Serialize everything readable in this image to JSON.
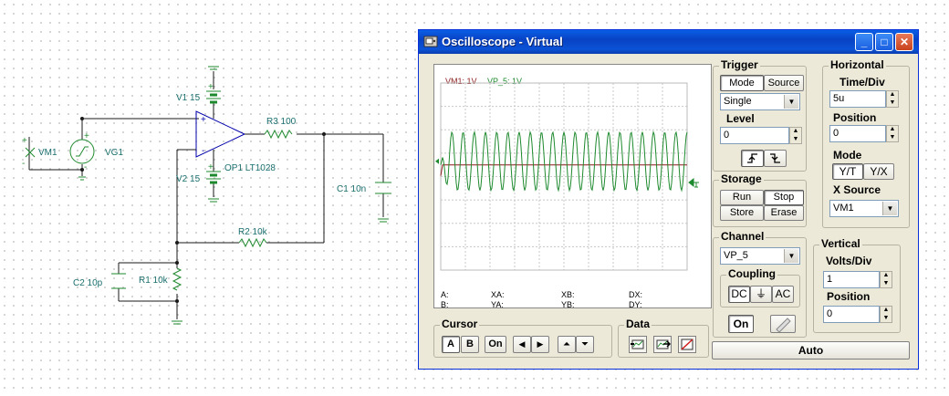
{
  "schematic": {
    "labels": {
      "vm1": "VM1",
      "vg1": "VG1",
      "v1": "V1 15",
      "v2": "V2 15",
      "r3": "R3 100",
      "op1": "OP1 LT1028",
      "c1": "C1 10n",
      "r2": "R2 10k",
      "c2": "C2 10p",
      "r1": "R1 10k"
    },
    "signs": {
      "plus": "+",
      "minus": "-"
    }
  },
  "window": {
    "title": "Oscilloscope - Virtual",
    "controls": {
      "minimize": "_",
      "maximize": "□",
      "close": "✕"
    }
  },
  "scope": {
    "channel_labels": {
      "vm1": "VM1: 1V",
      "vp5": "VP_5: 1V"
    },
    "trace_colors": {
      "vm1": "#8b1a1a",
      "vp5": "#1e8a2e"
    },
    "cursor_readouts": {
      "a": "A:",
      "b": "B:",
      "xa": "XA:",
      "ya": "YA:",
      "xb": "XB:",
      "yb": "YB:",
      "dx": "DX:",
      "dy": "DY:"
    }
  },
  "cursor": {
    "title": "Cursor",
    "buttons": {
      "a": "A",
      "b": "B",
      "on": "On",
      "left": "◀",
      "right": "▶",
      "up": "⏶",
      "down": "⏷"
    }
  },
  "data_group": {
    "title": "Data"
  },
  "trigger": {
    "title": "Trigger",
    "mode_label": "Mode",
    "source_label": "Source",
    "mode_value": "Single",
    "level_label": "Level",
    "level_value": "0",
    "rising_glyph": "⎍",
    "falling_glyph": "⎍"
  },
  "storage": {
    "title": "Storage",
    "run": "Run",
    "stop": "Stop",
    "store": "Store",
    "erase": "Erase"
  },
  "channel": {
    "title": "Channel",
    "value": "VP_5",
    "coupling_title": "Coupling",
    "dc": "DC",
    "ground_glyph": "⏚",
    "ac": "AC",
    "on": "On"
  },
  "horizontal": {
    "title": "Horizontal",
    "time_div_label": "Time/Div",
    "time_div_value": "5u",
    "position_label": "Position",
    "position_value": "0",
    "mode_label": "Mode",
    "yt": "Y/T",
    "yx": "Y/X",
    "x_source_label": "X Source",
    "x_source_value": "VM1"
  },
  "vertical": {
    "title": "Vertical",
    "volts_div_label": "Volts/Div",
    "volts_div_value": "1",
    "position_label": "Position",
    "position_value": "0"
  },
  "auto_button": "Auto"
}
